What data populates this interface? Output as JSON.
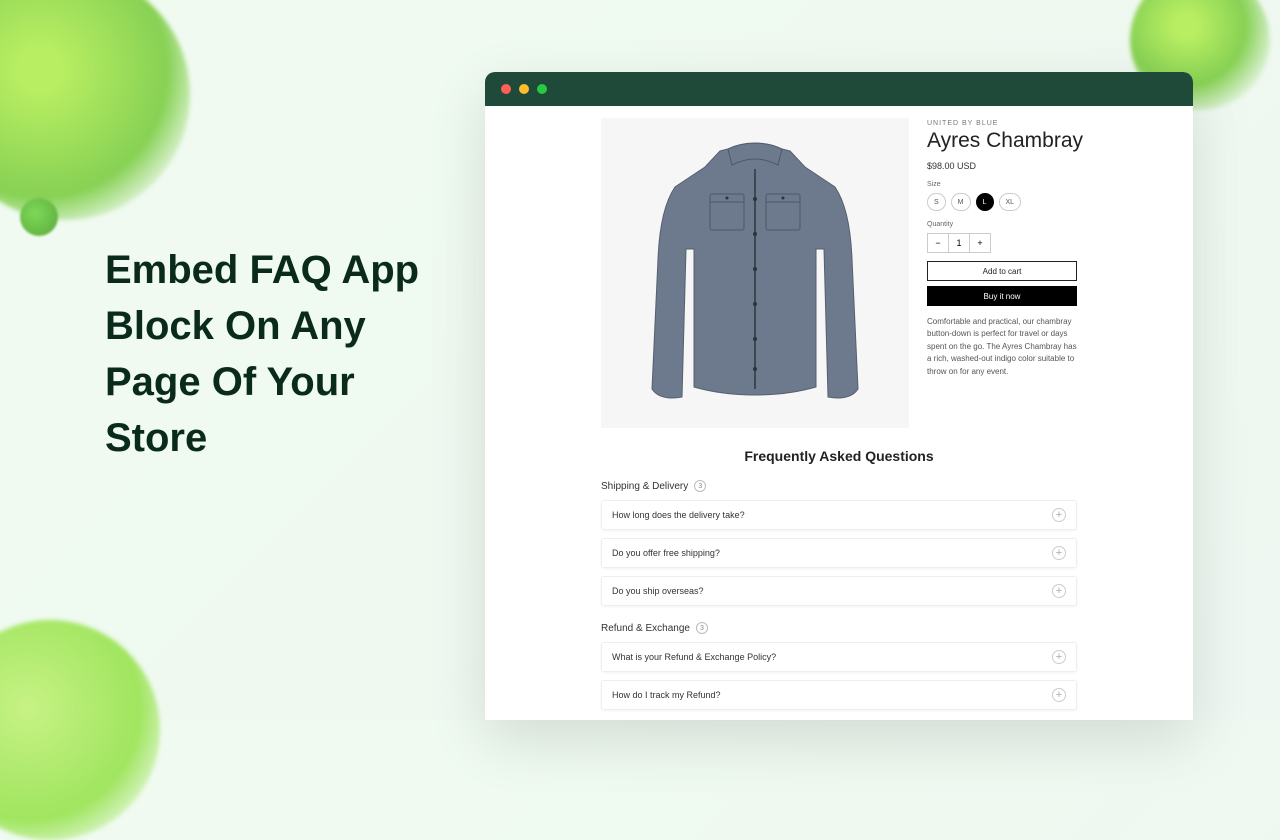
{
  "headline": "Embed FAQ App Block On Any Page Of Your Store",
  "product": {
    "brand": "UNITED BY BLUE",
    "title": "Ayres Chambray",
    "price": "$98.00 USD",
    "size_label": "Size",
    "sizes": [
      "S",
      "M",
      "L",
      "XL"
    ],
    "selected_size": "L",
    "qty_label": "Quantity",
    "qty_value": "1",
    "add_to_cart": "Add to cart",
    "buy_now": "Buy it now",
    "description": "Comfortable and practical, our chambray button-down is perfect for travel or days spent on the go. The Ayres Chambray has a rich, washed-out indigo color suitable to throw on for any event."
  },
  "faq": {
    "title": "Frequently Asked Questions",
    "categories": [
      {
        "name": "Shipping & Delivery",
        "count": "3",
        "items": [
          "How long does the delivery take?",
          "Do you offer free shipping?",
          "Do you ship overseas?"
        ]
      },
      {
        "name": "Refund & Exchange",
        "count": "3",
        "items": [
          "What is your Refund & Exchange Policy?",
          "How do I track my Refund?"
        ]
      }
    ]
  }
}
